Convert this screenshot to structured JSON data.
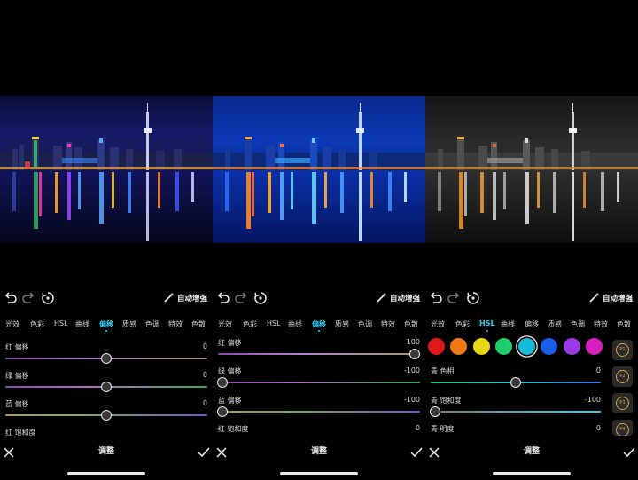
{
  "panels": [
    {
      "tabs": [
        "光效",
        "色彩",
        "HSL",
        "曲线",
        "偏移",
        "质感",
        "色调",
        "特效",
        "色散"
      ],
      "active_tab": 4,
      "auto_label": "自动增强",
      "sliders": [
        {
          "label": "红 偏移",
          "value": "0"
        },
        {
          "label": "绿 偏移",
          "value": "0"
        },
        {
          "label": "蓝 偏移",
          "value": "0"
        },
        {
          "label": "红 饱和度",
          "value": ""
        }
      ],
      "footer_title": "调整"
    },
    {
      "tabs": [
        "光效",
        "色彩",
        "HSL",
        "曲线",
        "偏移",
        "质感",
        "色调",
        "特效",
        "色散"
      ],
      "active_tab": 4,
      "auto_label": "自动增强",
      "sliders": [
        {
          "label": "红 偏移",
          "value": "100"
        },
        {
          "label": "绿 偏移",
          "value": "-100"
        },
        {
          "label": "蓝 偏移",
          "value": "-100"
        },
        {
          "label": "红 饱和度",
          "value": "0"
        }
      ],
      "footer_title": "调整"
    },
    {
      "tabs": [
        "光效",
        "色彩",
        "HSL",
        "曲线",
        "偏移",
        "质感",
        "色调",
        "特效",
        "色散"
      ],
      "active_tab": 2,
      "auto_label": "自动增强",
      "colors": [
        "#e01a1a",
        "#f07a12",
        "#e6d812",
        "#1ccf6a",
        "#16b9d6",
        "#1a5de8",
        "#9a3be6",
        "#d81fc0"
      ],
      "selected_color": 4,
      "sliders": [
        {
          "label": "青 色相",
          "value": "0"
        },
        {
          "label": "青 饱和度",
          "value": "-100"
        },
        {
          "label": "青 明度",
          "value": "0"
        }
      ],
      "presets": [
        "P1",
        "P2",
        "P3",
        "P4"
      ],
      "footer_title": "调整"
    }
  ]
}
